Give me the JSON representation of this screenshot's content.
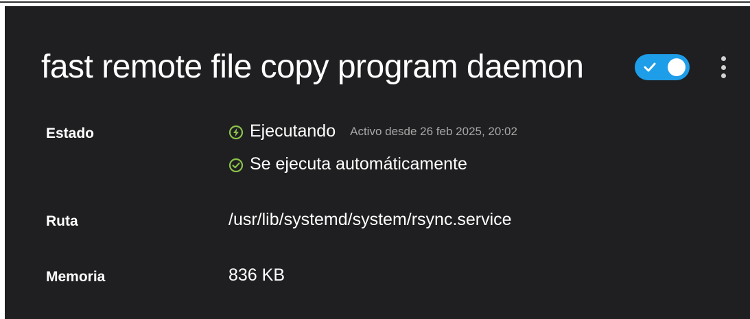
{
  "service": {
    "title": "fast remote file copy program daemon",
    "enabled": true
  },
  "status": {
    "label": "Estado",
    "running_text": "Ejecutando",
    "active_since": "Activo desde 26 feb 2025, 20:02",
    "auto_text": "Se ejecuta automáticamente"
  },
  "path": {
    "label": "Ruta",
    "value": "/usr/lib/systemd/system/rsync.service"
  },
  "memory": {
    "label": "Memoria",
    "value": "836 KB"
  },
  "colors": {
    "background": "#1f1f21",
    "toggle_on": "#1e9de8",
    "status_green": "#8bc34a",
    "muted_text": "#a8a8a8"
  },
  "icons": {
    "running": "lightning-circle-icon",
    "auto": "check-circle-icon",
    "menu": "kebab-menu-icon",
    "toggle_check": "check-icon"
  }
}
